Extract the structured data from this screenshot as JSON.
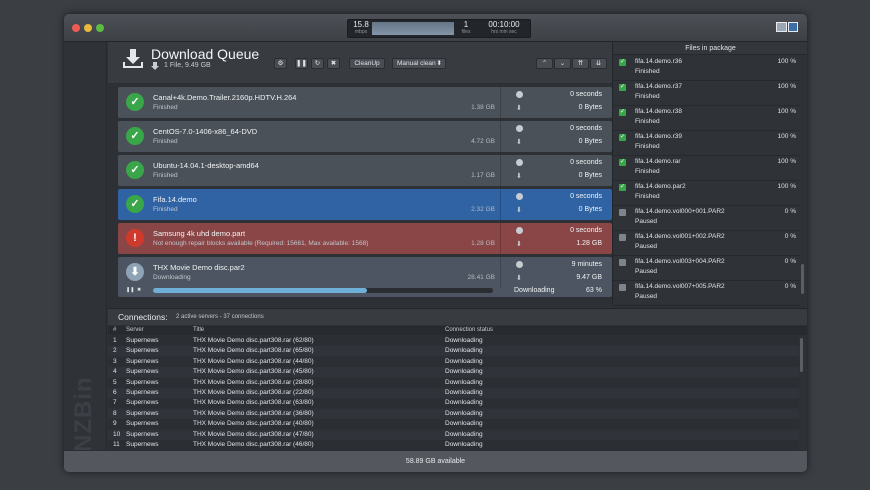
{
  "stats": {
    "speed": "15.8",
    "speed_unit": "mbps",
    "files": "1",
    "files_unit": "files",
    "time": "00:10:00",
    "time_unit": "hrs  min  sec"
  },
  "queue": {
    "title": "Download Queue",
    "subtitle": "1 File, 9.49 GB",
    "cleanup_label": "CleanUp",
    "manual_clean_label": "Manual clean",
    "items": [
      {
        "name": "Canal+4k.Demo.Trailer.2160p.HDTV.H.264",
        "status": "Finished",
        "size": "1.38 GB",
        "time": "0 seconds",
        "bytes": "0 Bytes",
        "state": "done"
      },
      {
        "name": "CentOS-7.0-1406-x86_64-DVD",
        "status": "Finished",
        "size": "4.72 GB",
        "time": "0 seconds",
        "bytes": "0 Bytes",
        "state": "done"
      },
      {
        "name": "Ubuntu-14.04.1-desktop-amd64",
        "status": "Finished",
        "size": "1.17 GB",
        "time": "0 seconds",
        "bytes": "0 Bytes",
        "state": "done"
      },
      {
        "name": "Fifa.14.demo",
        "status": "Finished",
        "size": "2.32 GB",
        "time": "0 seconds",
        "bytes": "0 Bytes",
        "state": "selected"
      },
      {
        "name": "Samsung 4k uhd demo.part",
        "status": "Not enough repair blocks available (Required: 15661, Max available: 1568)",
        "size": "1.28 GB",
        "time": "0 seconds",
        "bytes": "1.28 GB",
        "state": "error"
      },
      {
        "name": "THX Movie Demo disc.par2",
        "status": "Downloading",
        "size": "28.41 GB",
        "time": "9 minutes",
        "bytes": "9.47 GB",
        "state": "downloading",
        "progress_label": "Downloading",
        "progress_pct": "63  %",
        "progress": 0.63
      }
    ]
  },
  "files_panel": {
    "title": "Files in package",
    "files": [
      {
        "name": "fifa.14.demo.r36",
        "status": "Finished",
        "pct": "100 %",
        "checked": true
      },
      {
        "name": "fifa.14.demo.r37",
        "status": "Finished",
        "pct": "100 %",
        "checked": true
      },
      {
        "name": "fifa.14.demo.r38",
        "status": "Finished",
        "pct": "100 %",
        "checked": true
      },
      {
        "name": "fifa.14.demo.r39",
        "status": "Finished",
        "pct": "100 %",
        "checked": true
      },
      {
        "name": "fifa.14.demo.rar",
        "status": "Finished",
        "pct": "100 %",
        "checked": true
      },
      {
        "name": "fifa.14.demo.par2",
        "status": "Finished",
        "pct": "100 %",
        "checked": true
      },
      {
        "name": "fifa.14.demo.vol000+001.PAR2",
        "status": "Paused",
        "pct": "0 %",
        "checked": false
      },
      {
        "name": "fifa.14.demo.vol001+002.PAR2",
        "status": "Paused",
        "pct": "0 %",
        "checked": false
      },
      {
        "name": "fifa.14.demo.vol003+004.PAR2",
        "status": "Paused",
        "pct": "0 %",
        "checked": false
      },
      {
        "name": "fifa.14.demo.vol007+005.PAR2",
        "status": "Paused",
        "pct": "0 %",
        "checked": false
      }
    ]
  },
  "connections": {
    "title": "Connections:",
    "summary": "2 active servers  -  37 connections",
    "columns": [
      "#",
      "Server",
      "Title",
      "Connection status"
    ],
    "rows": [
      [
        "1",
        "Supernews",
        "THX Movie Demo disc.part308.rar (62/80)",
        "Downloading"
      ],
      [
        "2",
        "Supernews",
        "THX Movie Demo disc.part308.rar (65/80)",
        "Downloading"
      ],
      [
        "3",
        "Supernews",
        "THX Movie Demo disc.part308.rar (44/80)",
        "Downloading"
      ],
      [
        "4",
        "Supernews",
        "THX Movie Demo disc.part308.rar (45/80)",
        "Downloading"
      ],
      [
        "5",
        "Supernews",
        "THX Movie Demo disc.part308.rar (28/80)",
        "Downloading"
      ],
      [
        "6",
        "Supernews",
        "THX Movie Demo disc.part308.rar (22/80)",
        "Downloading"
      ],
      [
        "7",
        "Supernews",
        "THX Movie Demo disc.part308.rar (63/80)",
        "Downloading"
      ],
      [
        "8",
        "Supernews",
        "THX Movie Demo disc.part308.rar (36/80)",
        "Downloading"
      ],
      [
        "9",
        "Supernews",
        "THX Movie Demo disc.part308.rar (40/80)",
        "Downloading"
      ],
      [
        "10",
        "Supernews",
        "THX Movie Demo disc.part308.rar (47/80)",
        "Downloading"
      ],
      [
        "11",
        "Supernews",
        "THX Movie Demo disc.part308.rar (46/80)",
        "Downloading"
      ]
    ]
  },
  "footer": {
    "available": "58.89 GB available"
  },
  "brand": "NZBin",
  "colors": {
    "done": "#4a5158",
    "selected": "#2f63a4",
    "error": "#8a4646",
    "downloading": "#4c5561",
    "check": "#3aa64a",
    "error_icon": "#d03a2c",
    "progress": "#6fb0d8"
  }
}
